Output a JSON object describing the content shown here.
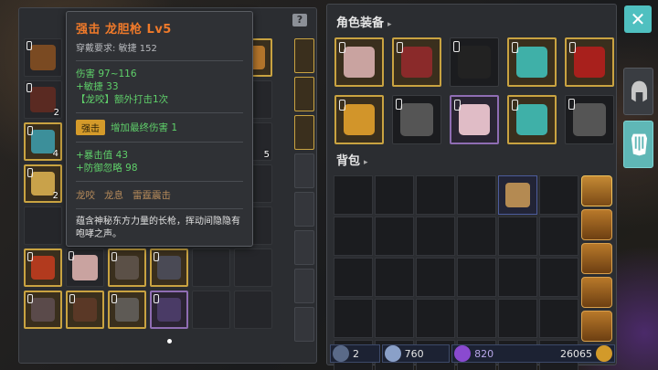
{
  "tooltip": {
    "title": "强击 龙胆枪 Lv5",
    "requirement_label": "穿戴要求:",
    "requirement_value": "敏捷 152",
    "stat_damage": "伤害  97~116",
    "stat_agility": "+敏捷 33",
    "stat_special": "【龙咬】额外打击1次",
    "chip_label": "强击",
    "chip_effect": "增加最终伤害 1",
    "stat_crit": "+暴击值 43",
    "stat_ignore_def": "+防御忽略 98",
    "set_1": "龙咬",
    "set_2": "龙息",
    "set_3": "雷霆震击",
    "description": "蕴含神秘东方力量的长枪，挥动间隐隐有咆哮之声。"
  },
  "left_panel": {
    "help_label": "?",
    "slots": [
      {
        "icon": "pouch-icon",
        "count": "",
        "style": "dim",
        "color": "#7a4a22"
      },
      {
        "icon": "",
        "count": "",
        "style": "dim",
        "color": ""
      },
      {
        "icon": "",
        "count": "",
        "style": "dim",
        "color": ""
      },
      {
        "icon": "",
        "count": "",
        "style": "dim",
        "color": ""
      },
      {
        "icon": "",
        "count": "",
        "style": "dim",
        "color": ""
      },
      {
        "icon": "bag-icon",
        "count": "",
        "style": "gold",
        "color": "#b2742b"
      },
      {
        "icon": "claws-icon",
        "count": "2",
        "style": "dim",
        "color": "#5a2a22"
      },
      {
        "icon": "",
        "count": "",
        "style": "dim",
        "color": ""
      },
      {
        "icon": "",
        "count": "",
        "style": "dim",
        "color": ""
      },
      {
        "icon": "",
        "count": "",
        "style": "dim",
        "color": ""
      },
      {
        "icon": "",
        "count": "",
        "style": "dim",
        "color": ""
      },
      {
        "icon": "",
        "count": "",
        "style": "dim",
        "color": ""
      },
      {
        "icon": "crystal-icon",
        "count": "4",
        "style": "gold",
        "color": "#3c8f9a"
      },
      {
        "icon": "",
        "count": "",
        "style": "dim",
        "color": ""
      },
      {
        "icon": "",
        "count": "",
        "style": "dim",
        "color": ""
      },
      {
        "icon": "",
        "count": "",
        "style": "dim",
        "color": ""
      },
      {
        "icon": "",
        "count": "",
        "style": "dim",
        "color": ""
      },
      {
        "icon": "",
        "count": "5",
        "style": "dim",
        "color": ""
      },
      {
        "icon": "scroll-icon",
        "count": "2",
        "style": "gold",
        "color": "#c9a24a"
      },
      {
        "icon": "",
        "count": "",
        "style": "dim",
        "color": ""
      },
      {
        "icon": "",
        "count": "",
        "style": "dim",
        "color": ""
      },
      {
        "icon": "",
        "count": "",
        "style": "dim",
        "color": ""
      },
      {
        "icon": "",
        "count": "",
        "style": "dim",
        "color": ""
      },
      {
        "icon": "",
        "count": "",
        "style": "dim",
        "color": ""
      },
      {
        "icon": "",
        "count": "",
        "style": "dim",
        "color": ""
      },
      {
        "icon": "",
        "count": "",
        "style": "dim",
        "color": ""
      },
      {
        "icon": "",
        "count": "",
        "style": "dim",
        "color": ""
      },
      {
        "icon": "",
        "count": "",
        "style": "dim",
        "color": ""
      },
      {
        "icon": "",
        "count": "",
        "style": "dim",
        "color": ""
      },
      {
        "icon": "",
        "count": "",
        "style": "dim",
        "color": ""
      },
      {
        "icon": "ring-icon",
        "count": "",
        "style": "gold",
        "color": "#b23a1e"
      },
      {
        "icon": "boots-icon",
        "count": "",
        "style": "dim",
        "color": "#c9a3a0"
      },
      {
        "icon": "glove-icon",
        "count": "",
        "style": "gold",
        "color": "#5b5047"
      },
      {
        "icon": "gauntlet-icon",
        "count": "",
        "style": "gold",
        "color": "#4a4a55"
      },
      {
        "icon": "",
        "count": "",
        "style": "dim",
        "color": ""
      },
      {
        "icon": "",
        "count": "",
        "style": "dim",
        "color": ""
      },
      {
        "icon": "helmet-icon",
        "count": "",
        "style": "gold",
        "color": "#5a4a4a"
      },
      {
        "icon": "armor-icon",
        "count": "",
        "style": "gold",
        "color": "#5a3826"
      },
      {
        "icon": "mace-icon",
        "count": "",
        "style": "gold",
        "color": "#5e5a55"
      },
      {
        "icon": "robe-icon",
        "count": "",
        "style": "purple",
        "color": "#4a3b66"
      },
      {
        "icon": "",
        "count": "",
        "style": "dim",
        "color": ""
      },
      {
        "icon": "",
        "count": "",
        "style": "dim",
        "color": ""
      }
    ]
  },
  "equipment": {
    "title": "角色装备",
    "caret": "▸",
    "slots": [
      {
        "icon": "helmet-icon",
        "style": "gold",
        "color": "#c9a3a0"
      },
      {
        "icon": "armor-icon",
        "style": "gold",
        "color": "#8a2a2a"
      },
      {
        "icon": "belt-icon",
        "style": "dim",
        "color": "#222"
      },
      {
        "icon": "ring-icon",
        "style": "gold",
        "color": "#3fb0a8"
      },
      {
        "icon": "spear-icon",
        "style": "gold",
        "color": "#a8201c"
      },
      {
        "icon": "amulet-icon",
        "style": "gold",
        "color": "#d2952a"
      },
      {
        "icon": "gauntlet-icon",
        "style": "dim",
        "color": "#555"
      },
      {
        "icon": "boots-icon",
        "style": "purple",
        "color": "#e0bcc6"
      },
      {
        "icon": "ring-icon",
        "style": "gold",
        "color": "#3fb0a8"
      },
      {
        "icon": "sword-icon",
        "style": "dim",
        "color": "#555"
      }
    ]
  },
  "bag": {
    "title": "背包",
    "caret": "▸",
    "filled_index": 4,
    "filled_icon": "map-icon",
    "filled_color": "#b48a52"
  },
  "currency": {
    "item1": "2",
    "item2": "760",
    "item3": "820",
    "gold": "26065"
  },
  "sidebar": {
    "close_label": "✕"
  }
}
